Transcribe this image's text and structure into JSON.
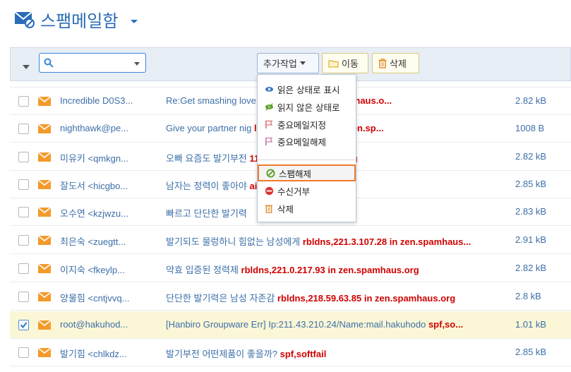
{
  "header": {
    "title": "스팸메일함",
    "icon": "mail-spam-icon"
  },
  "toolbar": {
    "search_placeholder": "",
    "more_actions_label": "추가작업",
    "move_label": "이동",
    "delete_label": "삭제"
  },
  "menu": {
    "items": [
      {
        "label": "읽은 상태로 표시",
        "icon": "eye-icon",
        "color": "#3a78c2"
      },
      {
        "label": "읽지 않은 상태로",
        "icon": "eye-off-icon",
        "color": "#5aa02c"
      },
      {
        "label": "중요메일지정",
        "icon": "flag-icon",
        "color": "#d66"
      },
      {
        "label": "중요메일해제",
        "icon": "flag-outline-icon",
        "color": "#c76fa0"
      },
      {
        "label": "스팸해제",
        "icon": "no-spam-icon",
        "color": "#5aa02c",
        "highlighted": true
      },
      {
        "label": "수신거부",
        "icon": "block-icon",
        "color": "#d33"
      },
      {
        "label": "삭제",
        "icon": "trash-icon",
        "color": "#e08a2a"
      }
    ]
  },
  "rows": [
    {
      "sender": "Incredible D0S3...",
      "subject": "Re:Get smashing love",
      "spam": "245.25.69 in zen.spamhaus.o...",
      "size": "2.82 kB",
      "checked": false
    },
    {
      "sender": "nighthawk@pe...",
      "subject": "Give your partner nig",
      "spam": "ldns,5.251.143.216 in zen.sp...",
      "size": "1008 B",
      "checked": false
    },
    {
      "sender": "미유키 <qmkgn...",
      "subject": "오빠 요즘도 발기부전",
      "spam": "111 in zen.spamhaus.org",
      "size": "2.82 kB",
      "checked": false
    },
    {
      "sender": "잘도서 <hicgbo...",
      "subject": "남자는 정력이 좋아야",
      "spam": "ail",
      "size": "2.85 kB",
      "checked": false
    },
    {
      "sender": "오수연 <kzjwzu...",
      "subject": "빠르고 단단한 발기력",
      "spam": "",
      "size": "2.83 kB",
      "checked": false
    },
    {
      "sender": "최은숙 <zuegtt...",
      "subject": "발기되도 물렁하니 힘없는 남성에게",
      "spam": "rbldns,221.3.107.28 in zen.spamhaus...",
      "size": "2.91 kB",
      "checked": false
    },
    {
      "sender": "이지숙 <fkeylp...",
      "subject": "약효 입증된 정력제",
      "spam": "rbldns,221.0.217.93 in zen.spamhaus.org",
      "size": "2.82 kB",
      "checked": false
    },
    {
      "sender": "양물힘 <cntjvvq...",
      "subject": "단단한 발기력은 남성 자존감",
      "spam": "rbldns,218.59.63.85 in zen.spamhaus.org",
      "size": "2.8 kB",
      "checked": false
    },
    {
      "sender": "root@hakuhod...",
      "subject": "[Hanbiro Groupware Err] Ip:211.43.210.24/Name:mail.hakuhodo",
      "spam": "spf,so...",
      "size": "1.01 kB",
      "checked": true
    },
    {
      "sender": "발기힘 <chlkdz...",
      "subject": "발기부전 어떤제품이 좋을까?",
      "spam": "spf,softfail",
      "size": "2.85 kB",
      "checked": false
    }
  ]
}
